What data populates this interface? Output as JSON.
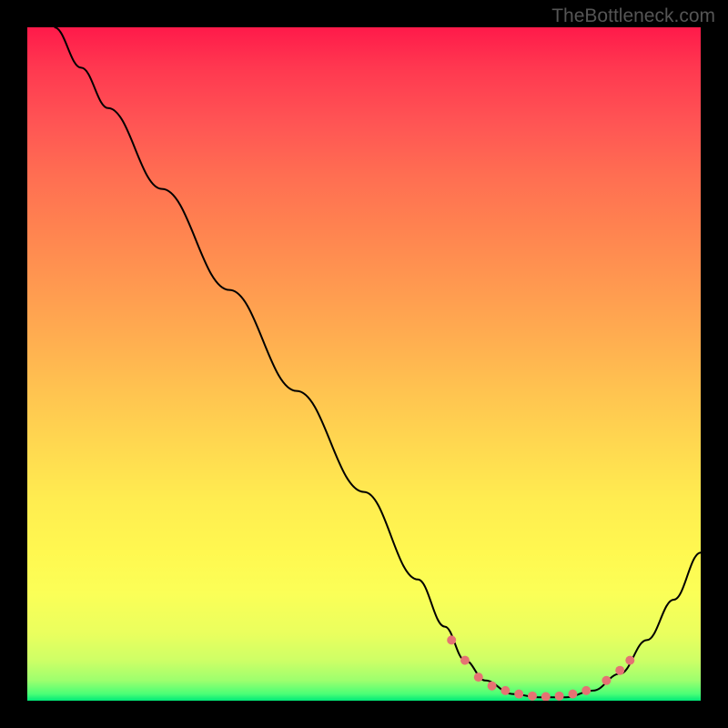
{
  "attribution": "TheBottleneck.com",
  "chart_data": {
    "type": "line",
    "title": "",
    "xlabel": "",
    "ylabel": "",
    "xlim": [
      0,
      100
    ],
    "ylim": [
      0,
      100
    ],
    "series": [
      {
        "name": "curve",
        "points": [
          {
            "x": 4,
            "y": 100
          },
          {
            "x": 8,
            "y": 94
          },
          {
            "x": 12,
            "y": 88
          },
          {
            "x": 20,
            "y": 76
          },
          {
            "x": 30,
            "y": 61
          },
          {
            "x": 40,
            "y": 46
          },
          {
            "x": 50,
            "y": 31
          },
          {
            "x": 58,
            "y": 18
          },
          {
            "x": 62,
            "y": 11
          },
          {
            "x": 65,
            "y": 6
          },
          {
            "x": 68,
            "y": 3
          },
          {
            "x": 72,
            "y": 1
          },
          {
            "x": 76,
            "y": 0.5
          },
          {
            "x": 80,
            "y": 0.5
          },
          {
            "x": 84,
            "y": 1.5
          },
          {
            "x": 88,
            "y": 4
          },
          {
            "x": 92,
            "y": 9
          },
          {
            "x": 96,
            "y": 15
          },
          {
            "x": 100,
            "y": 22
          }
        ]
      }
    ],
    "markers": [
      {
        "x": 63,
        "y": 9
      },
      {
        "x": 65,
        "y": 6
      },
      {
        "x": 67,
        "y": 3.5
      },
      {
        "x": 69,
        "y": 2.2
      },
      {
        "x": 71,
        "y": 1.5
      },
      {
        "x": 73,
        "y": 1
      },
      {
        "x": 75,
        "y": 0.7
      },
      {
        "x": 77,
        "y": 0.6
      },
      {
        "x": 79,
        "y": 0.7
      },
      {
        "x": 81,
        "y": 1
      },
      {
        "x": 83,
        "y": 1.5
      },
      {
        "x": 86,
        "y": 3
      },
      {
        "x": 88,
        "y": 4.5
      },
      {
        "x": 89.5,
        "y": 6
      }
    ]
  }
}
